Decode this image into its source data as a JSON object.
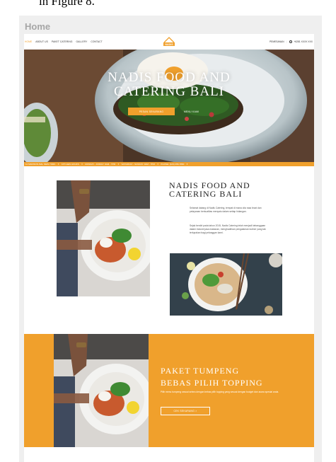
{
  "caption": "in Figure 8.",
  "page_label": "Home",
  "navbar": {
    "links": [
      "HOME",
      "ABOUT US",
      "PAKET CATERING",
      "GALLERY",
      "CONTACT"
    ],
    "logo_text": "NADIS",
    "right_text": "PEMESANAN",
    "phone": "+6281 XXXX XXX"
  },
  "hero": {
    "title_line1": "NADIS FOOD AND",
    "title_line2": "CATERING BALI",
    "primary_button": "PESAN SEKARANG",
    "secondary_link": "MENU KAMI"
  },
  "ticker": [
    "11 MADISON AVE, NEW YORK",
    "KITCHEN HOURS",
    "MONDAY - FRIDAY: 9AM - 7PM",
    "SATURDAY - SUNDAY: 9AM - 7PM",
    "PHONE: (123) 456-7890"
  ],
  "about": {
    "title_line1": "NADIS FOOD AND",
    "title_line2": "CATERING BALI",
    "paragraph1": "Selamat datang di Nadis Catering, tempat di mana cita rasa lezat dan pelayanan berkualitas menyatu dalam setiap hidangan.",
    "paragraph2": "Sejak berdiri pada tahun 2015, Nadis Catering telah menjadi kebanggaan dalam industri jasa makanan, menghadirkan pengalaman kuliner yang tak terlupakan bagi pelanggan kami."
  },
  "promo": {
    "title_line1": "PAKET TUMPENG",
    "title_line2": "BEBAS PILIH TOPPING",
    "description": "Pilih menu tumpeng sesuai selera dengan bebas pilih topping yang sesuai dengan budget dan acara spesial anda.",
    "button": "CEK SEKARANG >"
  },
  "colors": {
    "accent": "#f0a02c",
    "frame": "#efefef"
  }
}
